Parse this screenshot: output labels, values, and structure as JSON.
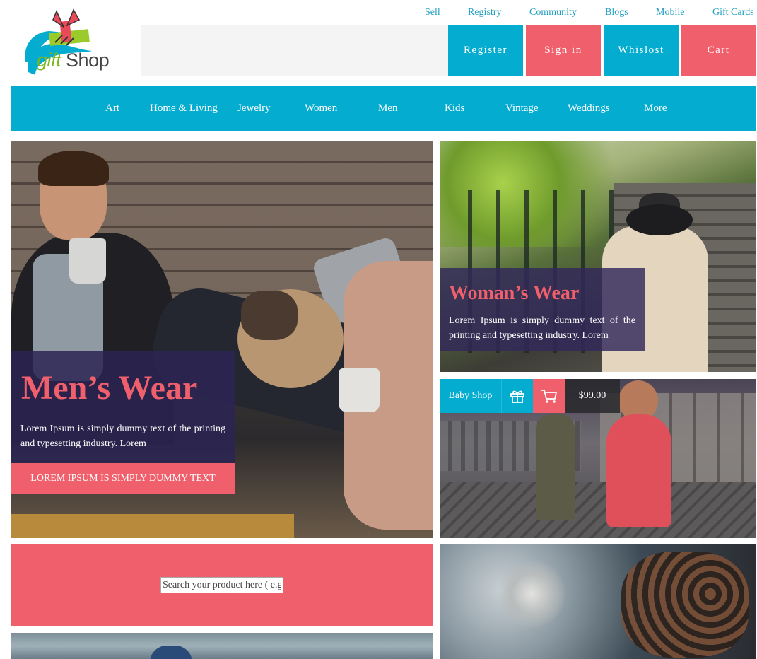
{
  "top_links": [
    {
      "label": "Sell"
    },
    {
      "label": "Registry"
    },
    {
      "label": "Community"
    },
    {
      "label": "Blogs"
    },
    {
      "label": "Mobile"
    },
    {
      "label": "Gift Cards"
    }
  ],
  "logo": {
    "word1": "gift",
    "word2": "Shop"
  },
  "header_buttons": {
    "register": "Register",
    "sign_in": "Sign in",
    "wishlist": "Whislost",
    "cart": "Cart"
  },
  "nav": [
    {
      "label": "Art"
    },
    {
      "label": "Home & Living"
    },
    {
      "label": "Jewelry"
    },
    {
      "label": "Women"
    },
    {
      "label": "Men"
    },
    {
      "label": "Kids"
    },
    {
      "label": "Vintage"
    },
    {
      "label": "Weddings"
    },
    {
      "label": "More"
    }
  ],
  "men": {
    "title": "Men’s Wear",
    "description": "Lorem Ipsum is simply dummy text of the printing and typesetting industry. Lorem",
    "cta": "LOREM IPSUM IS SIMPLY DUMMY TEXT"
  },
  "woman": {
    "title": "Woman’s Wear",
    "description": "Lorem Ipsum is simply dummy text of the printing and typesetting industry. Lorem"
  },
  "baby": {
    "label": "Baby Shop",
    "price": "$99.00"
  },
  "search": {
    "placeholder": "Search your product here ( e.g. shoes )"
  },
  "colors": {
    "teal": "#04acd0",
    "coral": "#f0606c",
    "card_purple": "#2c2454"
  }
}
